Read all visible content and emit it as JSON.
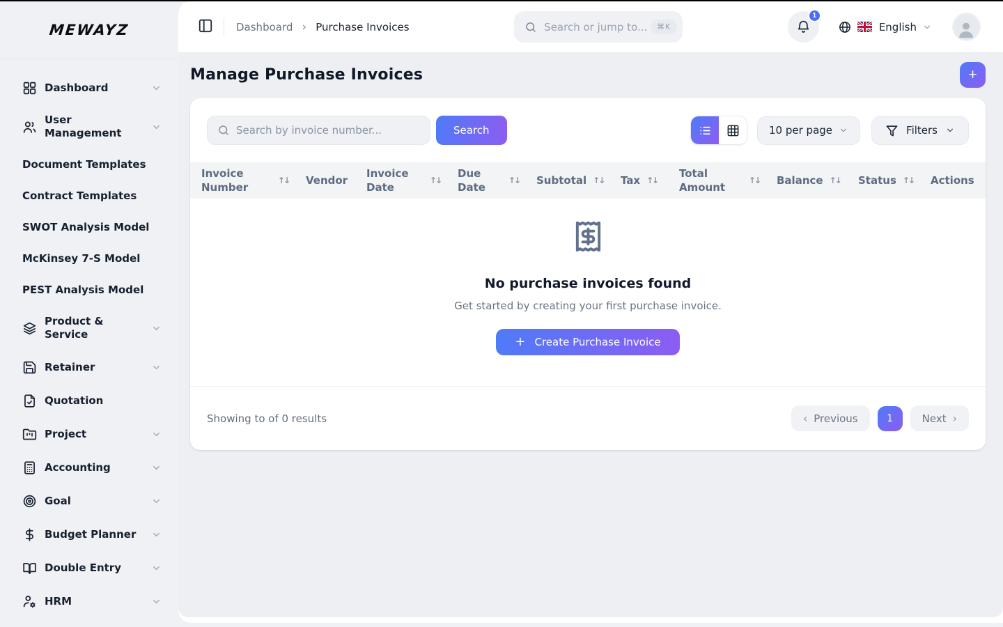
{
  "app": {
    "name": "MEWAYZ"
  },
  "header": {
    "breadcrumb": {
      "parent": "Dashboard",
      "separator": "›",
      "current": "Purchase Invoices"
    },
    "search": {
      "placeholder": "Search or jump to...",
      "shortcut": "⌘K"
    },
    "notifications": {
      "count": "1"
    },
    "language": {
      "label": "English"
    }
  },
  "sidebar": {
    "items": [
      {
        "label": "Dashboard",
        "icon": "grid",
        "chevron": true
      },
      {
        "label": "User Management",
        "icon": "users",
        "chevron": true
      },
      {
        "label": "Document Templates",
        "icon": null,
        "chevron": false
      },
      {
        "label": "Contract Templates",
        "icon": null,
        "chevron": false
      },
      {
        "label": "SWOT Analysis Model",
        "icon": null,
        "chevron": false
      },
      {
        "label": "McKinsey 7-S Model",
        "icon": null,
        "chevron": false
      },
      {
        "label": "PEST Analysis Model",
        "icon": null,
        "chevron": false
      },
      {
        "label": "Product & Service",
        "icon": "layers",
        "chevron": true
      },
      {
        "label": "Retainer",
        "icon": "save",
        "chevron": true
      },
      {
        "label": "Quotation",
        "icon": "file-check",
        "chevron": false
      },
      {
        "label": "Project",
        "icon": "folder-kanban",
        "chevron": true
      },
      {
        "label": "Accounting",
        "icon": "calculator",
        "chevron": true
      },
      {
        "label": "Goal",
        "icon": "target",
        "chevron": true
      },
      {
        "label": "Budget Planner",
        "icon": "dollar",
        "chevron": true
      },
      {
        "label": "Double Entry",
        "icon": "book-open",
        "chevron": true
      },
      {
        "label": "HRM",
        "icon": "user-cog",
        "chevron": true
      }
    ]
  },
  "page": {
    "title": "Manage Purchase Invoices",
    "add_button": "+"
  },
  "toolbar": {
    "search_placeholder": "Search by invoice number...",
    "search_button": "Search",
    "per_page": "10 per page",
    "filters_label": "Filters"
  },
  "table": {
    "sort_glyph": "↑↓",
    "columns": [
      {
        "label": "Invoice Number",
        "sortable": true
      },
      {
        "label": "Vendor",
        "sortable": false
      },
      {
        "label": "Invoice Date",
        "sortable": true
      },
      {
        "label": "Due Date",
        "sortable": true
      },
      {
        "label": "Subtotal",
        "sortable": true
      },
      {
        "label": "Tax",
        "sortable": true
      },
      {
        "label": "Total Amount",
        "sortable": true
      },
      {
        "label": "Balance",
        "sortable": true
      },
      {
        "label": "Status",
        "sortable": true
      },
      {
        "label": "Actions",
        "sortable": false
      }
    ]
  },
  "empty_state": {
    "title": "No purchase invoices found",
    "subtitle": "Get started by creating your first purchase invoice.",
    "cta_plus": "+",
    "cta_label": "Create Purchase Invoice"
  },
  "pagination": {
    "summary": "Showing to of 0 results",
    "previous_label": "Previous",
    "current_page": "1",
    "next_label": "Next"
  },
  "colors": {
    "accent_blue": "#4e7bf7",
    "accent_purple": "#8d5cf2",
    "badge_blue": "#4b6ef5",
    "sidebar_bg": "#f0f1f4",
    "content_bg": "#edeff3"
  }
}
